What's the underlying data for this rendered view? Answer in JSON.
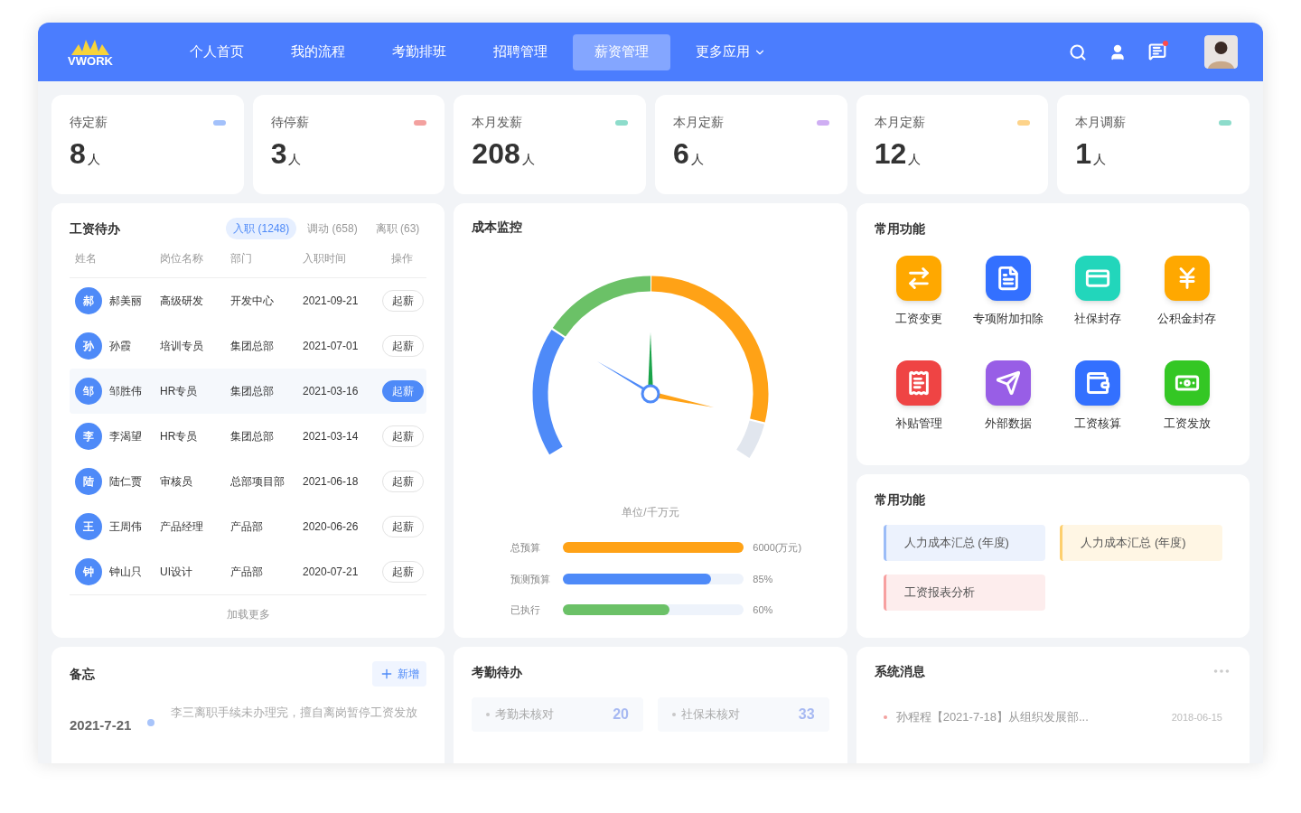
{
  "logo": {
    "text": "VWORK"
  },
  "nav": [
    {
      "label": "个人首页",
      "selected": false
    },
    {
      "label": "我的流程",
      "selected": false
    },
    {
      "label": "考勤排班",
      "selected": false
    },
    {
      "label": "招聘管理",
      "selected": false
    },
    {
      "label": "薪资管理",
      "selected": true
    },
    {
      "label": "更多应用",
      "selected": false,
      "kind": "dropdown"
    }
  ],
  "header_actions": {
    "notification_dot": true
  },
  "stats": [
    {
      "title": "待定薪",
      "value": "8",
      "unit": "人",
      "color": "#a3c1fb"
    },
    {
      "title": "待停薪",
      "value": "3",
      "unit": "人",
      "color": "#f3a19f"
    },
    {
      "title": "本月发薪",
      "value": "208",
      "unit": "人",
      "color": "#8ddccb"
    },
    {
      "title": "本月定薪",
      "value": "6",
      "unit": "人",
      "color": "#cfaef3"
    },
    {
      "title": "本月定薪",
      "value": "12",
      "unit": "人",
      "color": "#fdd38a"
    },
    {
      "title": "本月调薪",
      "value": "1",
      "unit": "人",
      "color": "#8ddccb"
    }
  ],
  "payroll_todo": {
    "title": "工资待办",
    "tabs": [
      {
        "label": "入职 (1248)",
        "selected": true
      },
      {
        "label": "调动 (658)",
        "selected": false
      },
      {
        "label": "离职 (63)",
        "selected": false
      }
    ],
    "columns": [
      "姓名",
      "岗位名称",
      "部门",
      "入职时间",
      "操作"
    ],
    "rows": [
      {
        "initial": "郝",
        "name": "郝美丽",
        "position": "高级研发",
        "department": "开发中心",
        "date": "2021-09-21",
        "action": "起薪",
        "selected": false
      },
      {
        "initial": "孙",
        "name": "孙霞",
        "position": "培训专员",
        "department": "集团总部",
        "date": "2021-07-01",
        "action": "起薪",
        "selected": false
      },
      {
        "initial": "邹",
        "name": "邹胜伟",
        "position": "HR专员",
        "department": "集团总部",
        "date": "2021-03-16",
        "action": "起薪",
        "selected": true
      },
      {
        "initial": "李",
        "name": "李渴望",
        "position": "HR专员",
        "department": "集团总部",
        "date": "2021-03-14",
        "action": "起薪",
        "selected": false
      },
      {
        "initial": "陆",
        "name": "陆仁贾",
        "position": "审核员",
        "department": "总部项目部",
        "date": "2021-06-18",
        "action": "起薪",
        "selected": false
      },
      {
        "initial": "王",
        "name": "王周伟",
        "position": "产品经理",
        "department": "产品部",
        "date": "2020-06-26",
        "action": "起薪",
        "selected": false
      },
      {
        "initial": "钟",
        "name": "钟山只",
        "position": "UI设计",
        "department": "产品部",
        "date": "2020-07-21",
        "action": "起薪",
        "selected": false
      }
    ],
    "load_more": "加载更多"
  },
  "cost_monitor": {
    "title": "成本监控",
    "unit": "单位/千万元",
    "bars": [
      {
        "label": "总预算",
        "level": 1,
        "reading": "6000(万元)",
        "color": "#ffa216"
      },
      {
        "label": "预测预算",
        "level": 0.82,
        "reading": "85%",
        "color": "#4e8af8"
      },
      {
        "label": "已执行",
        "level": 0.59,
        "reading": "60%",
        "color": "#6bc167"
      }
    ]
  },
  "functions": {
    "title": "常用功能",
    "items": [
      {
        "label": "工资变更",
        "color": "#ffa800"
      },
      {
        "label": "专项附加扣除",
        "color": "#3370ff"
      },
      {
        "label": "社保封存",
        "color": "#22d6bb"
      },
      {
        "label": "公积金封存",
        "color": "#ffa800"
      },
      {
        "label": "补贴管理",
        "color": "#ef4444"
      },
      {
        "label": "外部数据",
        "color": "#985ee6"
      },
      {
        "label": "工资核算",
        "color": "#3370ff"
      },
      {
        "label": "工资发放",
        "color": "#34c724"
      }
    ]
  },
  "quick_links": {
    "title": "常用功能",
    "items": [
      {
        "label": "人力成本汇总 (年度)",
        "color": "#9bbcf7"
      },
      {
        "label": "人力成本汇总 (年度)",
        "color": "#fdcf6e"
      },
      {
        "label": "工资报表分析",
        "color": "#f7a0a0"
      }
    ]
  },
  "memo": {
    "title": "备忘",
    "add_button": "新增",
    "entries": [
      {
        "date": "2021-7-21",
        "text": "李三离职手续未办理完，擅自离岗暂停工资发放"
      }
    ]
  },
  "attendance": {
    "title": "考勤待办",
    "items": [
      {
        "label": "考勤未核对",
        "count": "20"
      },
      {
        "label": "社保未核对",
        "count": "33"
      }
    ]
  },
  "messages": {
    "title": "系统消息",
    "items": [
      {
        "text": "孙程程【2021-7-18】从组织发展部...",
        "date": "2018-06-15"
      }
    ]
  }
}
